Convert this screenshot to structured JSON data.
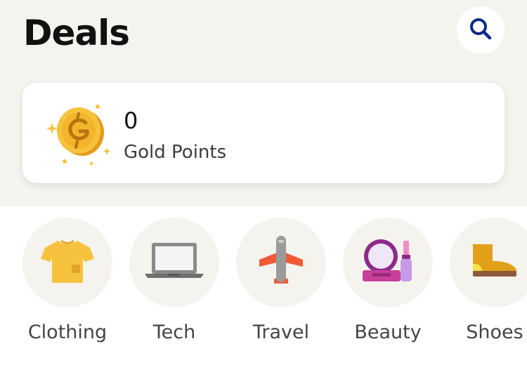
{
  "header": {
    "title": "Deals",
    "search_icon": "search-icon"
  },
  "points_card": {
    "value": "0",
    "label": "Gold Points",
    "icon": "gold-coin-icon",
    "accent": "#f6c23e"
  },
  "categories": [
    {
      "label": "Clothing",
      "icon": "tshirt-icon"
    },
    {
      "label": "Tech",
      "icon": "laptop-icon"
    },
    {
      "label": "Travel",
      "icon": "airplane-icon"
    },
    {
      "label": "Beauty",
      "icon": "makeup-icon"
    },
    {
      "label": "Shoes",
      "icon": "boot-icon"
    }
  ],
  "colors": {
    "background_top": "#f5f3ee",
    "card": "#ffffff",
    "search_icon": "#0b2a8a"
  }
}
